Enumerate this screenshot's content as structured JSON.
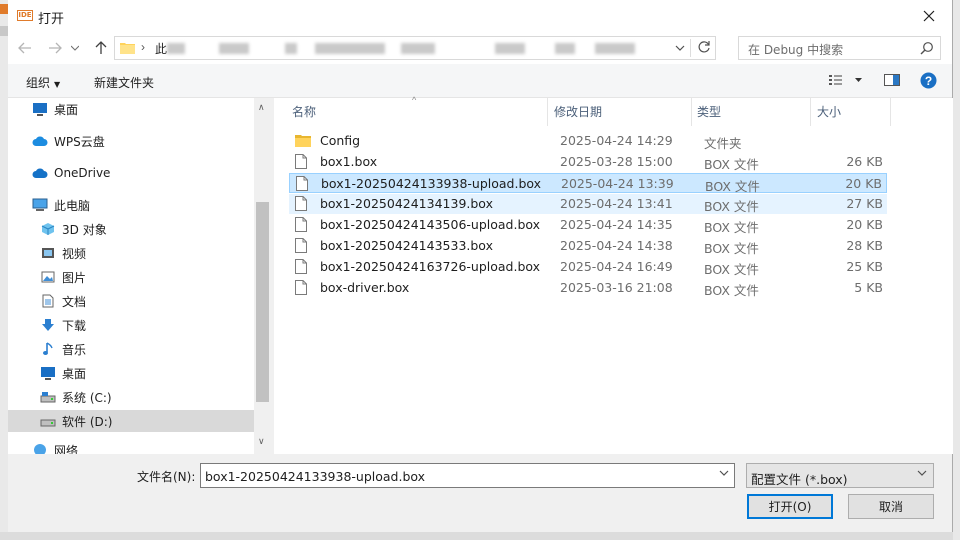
{
  "colors": {
    "accent": "#0078d7",
    "selection": "#cce8ff",
    "folder": "#ffd35c",
    "header_text": "#4c607a"
  },
  "window": {
    "title": "打开",
    "logo_text": "IDE",
    "close_icon": "close-icon"
  },
  "nav": {
    "back_icon": "arrow-left-icon",
    "forward_icon": "arrow-right-icon",
    "recent_icon": "chevron-down-icon",
    "up_icon": "arrow-up-icon",
    "address_path": "此",
    "refresh_icon": "refresh-icon",
    "search_placeholder": "在 Debug 中搜索"
  },
  "toolbar": {
    "organize_label": "组织",
    "new_folder_label": "新建文件夹",
    "view_icon": "view-list-icon",
    "preview_icon": "preview-pane-icon",
    "help_icon": "help-icon"
  },
  "sidebar": {
    "items": [
      {
        "label": "桌面",
        "icon": "desktop-icon"
      },
      {
        "label": "WPS云盘",
        "icon": "cloud-icon"
      },
      {
        "label": "OneDrive",
        "icon": "cloud-icon"
      },
      {
        "label": "此电脑",
        "icon": "computer-icon"
      },
      {
        "label": "3D 对象",
        "icon": "cube-icon"
      },
      {
        "label": "视频",
        "icon": "video-icon"
      },
      {
        "label": "图片",
        "icon": "picture-icon"
      },
      {
        "label": "文档",
        "icon": "document-icon"
      },
      {
        "label": "下载",
        "icon": "download-icon"
      },
      {
        "label": "音乐",
        "icon": "music-icon"
      },
      {
        "label": "桌面",
        "icon": "desktop-icon"
      },
      {
        "label": "系统 (C:)",
        "icon": "drive-icon"
      },
      {
        "label": "软件 (D:)",
        "icon": "drive-icon"
      },
      {
        "label": "网络",
        "icon": "network-icon"
      }
    ]
  },
  "columns": {
    "name": "名称",
    "date": "修改日期",
    "type": "类型",
    "size": "大小"
  },
  "files": [
    {
      "name": "Config",
      "date": "2025-04-24 14:29",
      "type": "文件夹",
      "size": ""
    },
    {
      "name": "box1.box",
      "date": "2025-03-28 15:00",
      "type": "BOX 文件",
      "size": "26 KB"
    },
    {
      "name": "box1-20250424133938-upload.box",
      "date": "2025-04-24 13:39",
      "type": "BOX 文件",
      "size": "20 KB"
    },
    {
      "name": "box1-20250424134139.box",
      "date": "2025-04-24 13:41",
      "type": "BOX 文件",
      "size": "27 KB"
    },
    {
      "name": "box1-20250424143506-upload.box",
      "date": "2025-04-24 14:35",
      "type": "BOX 文件",
      "size": "20 KB"
    },
    {
      "name": "box1-20250424143533.box",
      "date": "2025-04-24 14:38",
      "type": "BOX 文件",
      "size": "28 KB"
    },
    {
      "name": "box1-20250424163726-upload.box",
      "date": "2025-04-24 16:49",
      "type": "BOX 文件",
      "size": "25 KB"
    },
    {
      "name": "box-driver.box",
      "date": "2025-03-16 21:08",
      "type": "BOX 文件",
      "size": "5 KB"
    }
  ],
  "footer": {
    "filename_label": "文件名(N):",
    "filename_value": "box1-20250424133938-upload.box",
    "filter_value": "配置文件 (*.box)",
    "open_label": "打开(O)",
    "cancel_label": "取消"
  }
}
